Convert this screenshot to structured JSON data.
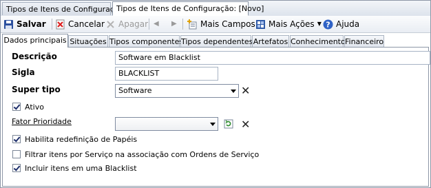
{
  "doc_tabs": [
    "Tipos de Itens de Configuração",
    "Tipos de Itens de Configuração: [Novo]"
  ],
  "toolbar": {
    "save": "Salvar",
    "cancel": "Cancelar",
    "delete": "Apagar",
    "more_fields": "Mais Campos",
    "more_actions": "Mais Ações",
    "help": "Ajuda"
  },
  "tabs": [
    "Dados principais",
    "Situações",
    "Tipos componentes",
    "Tipos dependentes",
    "Artefatos",
    "Conhecimento",
    "Financeiro"
  ],
  "form": {
    "description_label": "Descrição",
    "description_value": "Software em Blacklist",
    "sigla_label": "Sigla",
    "sigla_value": "BLACKLIST",
    "super_tipo_label": "Super tipo",
    "super_tipo_value": "Software",
    "ativo_label": "Ativo",
    "ativo_checked": true,
    "fator_label": "Fator Prioridade",
    "fator_value": "",
    "checkboxes": [
      {
        "label": "Habilita redefinição de Papéis",
        "checked": true
      },
      {
        "label": "Filtrar itens por Serviço na associação com Ordens de Serviço",
        "checked": false
      },
      {
        "label": "Incluir itens em uma Blacklist",
        "checked": true
      }
    ]
  },
  "colors": {
    "accent": "#1d3f8f",
    "delete_red": "#c0392b"
  }
}
